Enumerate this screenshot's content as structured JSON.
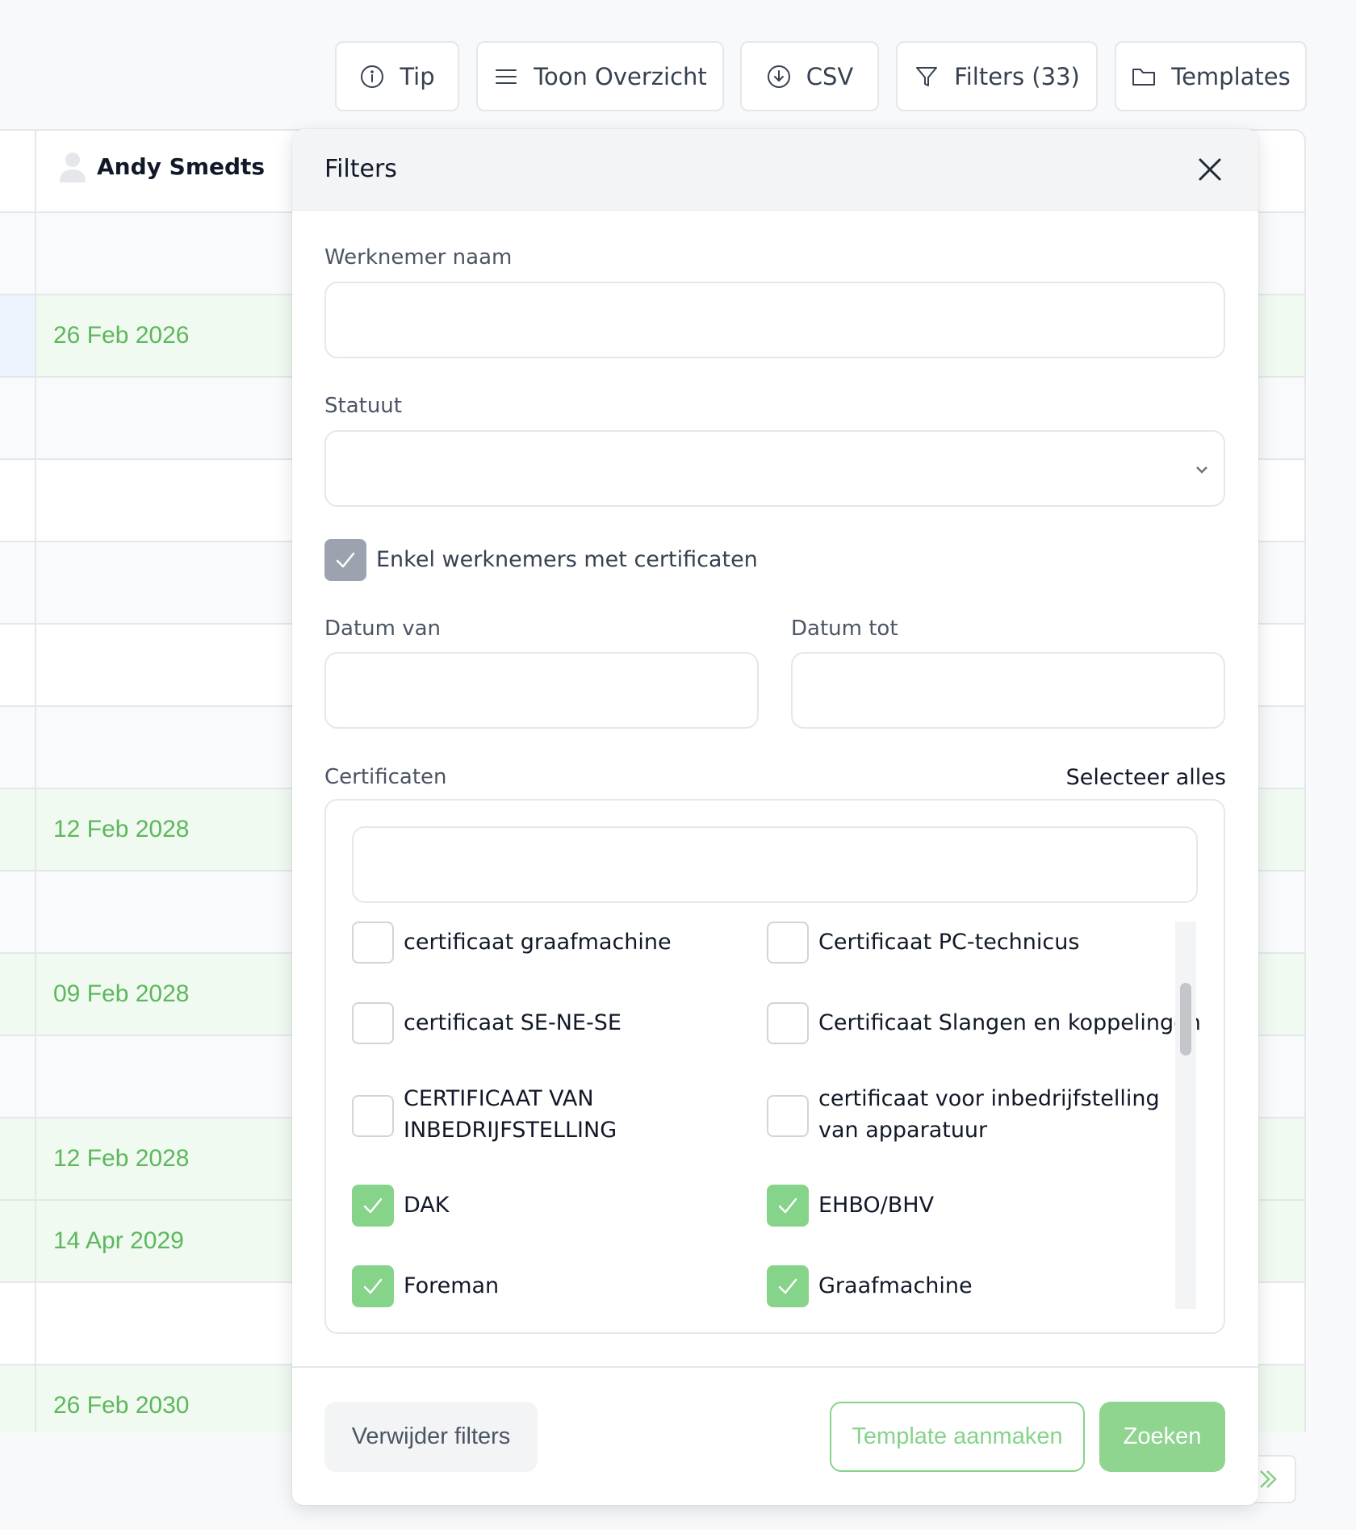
{
  "toolbar": {
    "tip_label": "Tip",
    "overview_label": "Toon Overzicht",
    "csv_label": "CSV",
    "filters_label": "Filters (33)",
    "templates_label": "Templates"
  },
  "table": {
    "employee_name": "Andy Smedts",
    "dates": [
      "26 Feb 2026",
      "12 Feb 2028",
      "09 Feb 2028",
      "12 Feb 2028",
      "14 Apr 2029",
      "26 Feb 2030"
    ]
  },
  "filters": {
    "title": "Filters",
    "employee_name_label": "Werknemer naam",
    "employee_name_value": "",
    "status_label": "Statuut",
    "status_value": "",
    "only_with_certificates_label": "Enkel werknemers met certificaten",
    "only_with_certificates_checked": true,
    "date_from_label": "Datum van",
    "date_from_value": "",
    "date_to_label": "Datum tot",
    "date_to_value": "",
    "certificates_label": "Certificaten",
    "select_all_label": "Selecteer alles",
    "certificate_search_value": "",
    "certificates": [
      {
        "label": "certificaat graafmachine",
        "checked": false
      },
      {
        "label": "Certificaat PC-technicus",
        "checked": false
      },
      {
        "label": "certificaat SE-NE-SE",
        "checked": false
      },
      {
        "label": "Certificaat Slangen en koppelingen",
        "checked": false
      },
      {
        "label": "CERTIFICAAT VAN INBEDRIJFSTELLING",
        "checked": false
      },
      {
        "label": "certificaat voor inbedrijfstelling van apparatuur",
        "checked": false
      },
      {
        "label": "DAK",
        "checked": true
      },
      {
        "label": "EHBO/BHV",
        "checked": true
      },
      {
        "label": "Foreman",
        "checked": true
      },
      {
        "label": "Graafmachine",
        "checked": true
      }
    ],
    "remove_filters_label": "Verwijder filters",
    "create_template_label": "Template aanmaken",
    "search_label": "Zoeken"
  },
  "colors": {
    "accent_green": "#86d38a",
    "date_green": "#5cb85c",
    "checkbox_gray": "#9ca3af"
  }
}
